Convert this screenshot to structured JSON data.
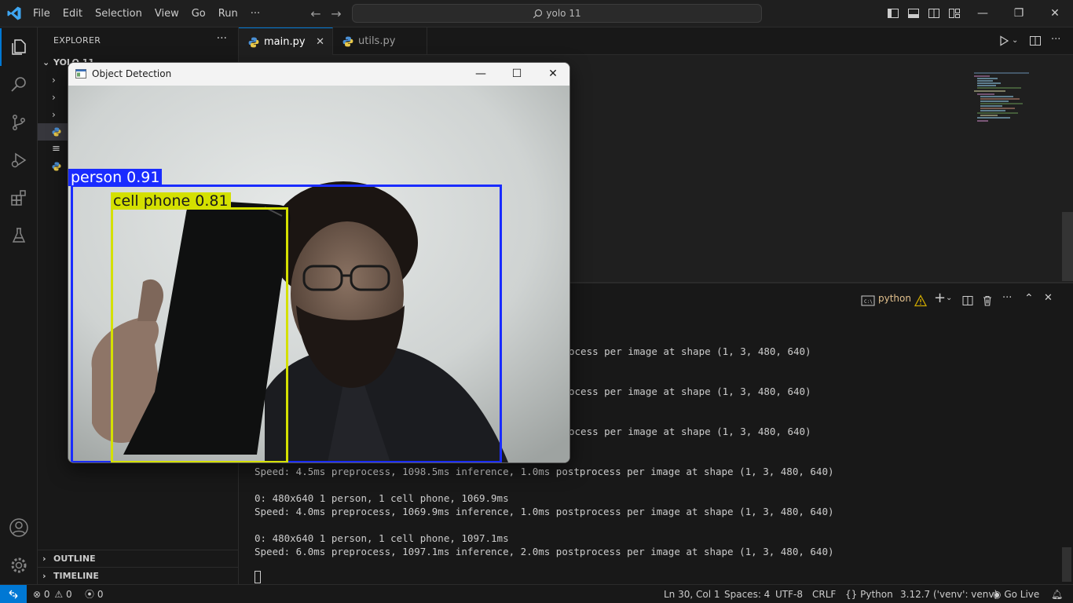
{
  "titlebar": {
    "menu": [
      "File",
      "Edit",
      "Selection",
      "View",
      "Go",
      "Run",
      "···"
    ],
    "search_text": "yolo 11",
    "window_controls": [
      "minimize",
      "restore",
      "close"
    ]
  },
  "activity_bar": [
    "explorer-icon",
    "search-icon",
    "source-control-icon",
    "run-debug-icon",
    "extensions-icon",
    "testing-icon",
    "accounts-icon",
    "manage-gear-icon"
  ],
  "sidebar": {
    "title": "EXPLORER",
    "more": "···",
    "workspace": "YOLO 11",
    "outline": "OUTLINE",
    "timeline": "TIMELINE"
  },
  "tabs": [
    {
      "label": "main.py",
      "active": true
    },
    {
      "label": "utils.py",
      "active": false
    }
  ],
  "panel": {
    "terminal_profile": "python",
    "lines": [
      {
        "text": "Speed: 4.5ms preprocess, 1098.5ms inference, 1.0ms postprocess per image at shape (1, 3, 480, 640)"
      },
      {
        "text": "0: 480x640 1 person, 1 cell phone, 1069.9ms"
      },
      {
        "text": "Speed: 4.0ms preprocess, 1069.9ms inference, 1.0ms postprocess per image at shape (1, 3, 480, 640)"
      },
      {
        "text": "0: 480x640 1 person, 1 cell phone, 1097.1ms"
      },
      {
        "text": "Speed: 6.0ms preprocess, 1097.1ms inference, 2.0ms postprocess per image at shape (1, 3, 480, 640)"
      }
    ],
    "partial_lines": [
      "ocess per image at shape (1, 3, 480, 640)",
      "ocess per image at shape (1, 3, 480, 640)",
      "ocess per image at shape (1, 3, 480, 640)"
    ]
  },
  "statusbar": {
    "errors": "0",
    "warnings": "0",
    "ports": "0",
    "position": "Ln 30, Col 1",
    "spaces": "Spaces: 4",
    "encoding": "UTF-8",
    "eol": "CRLF",
    "language": "Python",
    "interpreter": "3.12.7 ('venv': venv)",
    "golive": "Go Live"
  },
  "detection_window": {
    "title": "Object Detection",
    "detections": [
      {
        "label": "person 0.91",
        "color": "#1a2cff"
      },
      {
        "label": "cell phone 0.81",
        "color": "#d4e000"
      }
    ]
  },
  "colors": {
    "accent": "#0078d4",
    "warning": "#cca700",
    "person_box": "#1a2cff",
    "phone_box": "#d4e000"
  }
}
